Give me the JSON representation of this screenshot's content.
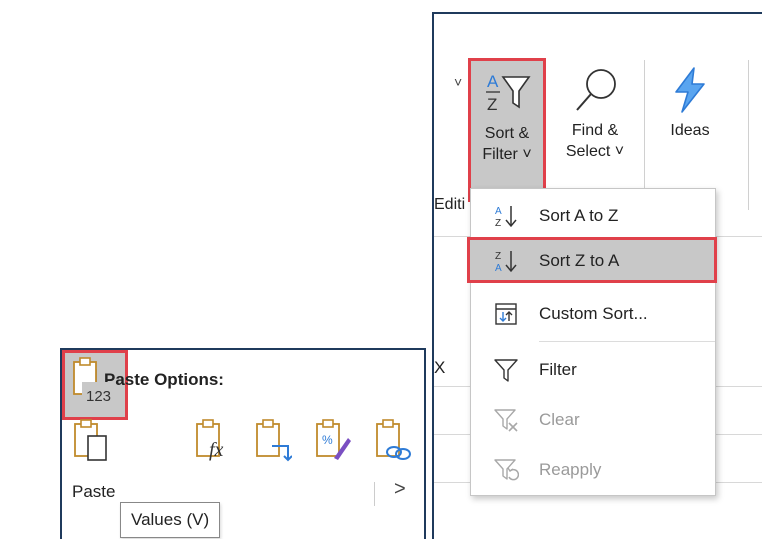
{
  "ribbon": {
    "sort_filter": {
      "line1": "Sort &",
      "line2": "Filter ˅"
    },
    "find_select": {
      "line1": "Find &",
      "line2": "Select ˅"
    },
    "ideas": {
      "label": "Ideas"
    },
    "group_label": "Editi",
    "column_header": "X",
    "expand_glyph": "˅"
  },
  "sort_menu": {
    "items": [
      {
        "label": "Sort A to Z",
        "icon": "sort-ascending-icon",
        "enabled": true
      },
      {
        "label": "Sort Z to A",
        "icon": "sort-descending-icon",
        "enabled": true,
        "highlighted": true
      },
      {
        "label": "Custom Sort...",
        "icon": "custom-sort-icon",
        "enabled": true
      },
      {
        "label": "Filter",
        "icon": "filter-icon",
        "enabled": true
      },
      {
        "label": "Clear",
        "icon": "clear-filter-icon",
        "enabled": false
      },
      {
        "label": "Reapply",
        "icon": "reapply-icon",
        "enabled": false
      }
    ]
  },
  "paste_options": {
    "title": "Paste Options:",
    "buttons": [
      "paste-icon",
      "paste-values-icon",
      "paste-formulas-icon",
      "paste-transpose-icon",
      "paste-formatting-icon",
      "paste-link-icon"
    ],
    "values_badge": "123",
    "row_label": "Paste",
    "row_arrow": ">",
    "tooltip": "Values (V)"
  },
  "colors": {
    "highlight_border": "#e0404a",
    "selected_bg": "#c8c8c8",
    "accent_blue": "#2e7bd6",
    "panel_border": "#1f3a5c"
  }
}
